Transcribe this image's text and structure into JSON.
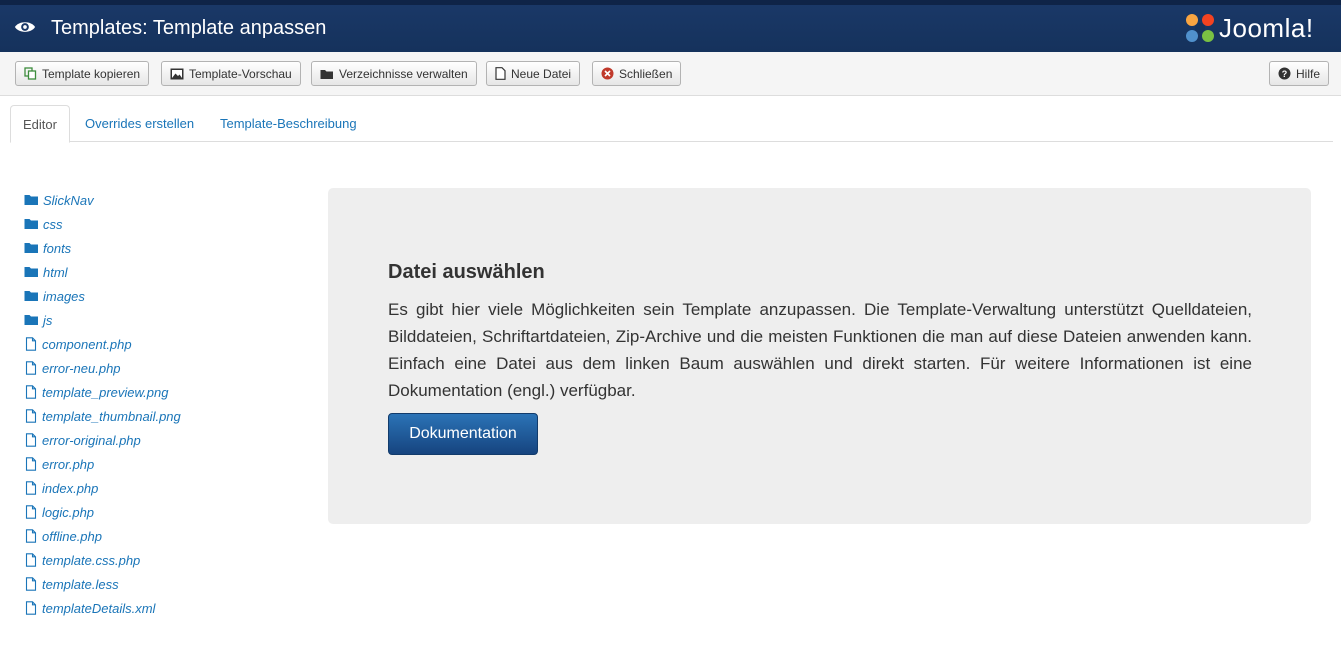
{
  "header": {
    "title": "Templates: Template anpassen",
    "logo_text": "Joomla!"
  },
  "toolbar": {
    "buttons": [
      {
        "label": "Template kopieren",
        "icon": "copy-icon"
      },
      {
        "label": "Template-Vorschau",
        "icon": "picture-icon"
      },
      {
        "label": "Verzeichnisse verwalten",
        "icon": "folder-icon"
      },
      {
        "label": "Neue Datei",
        "icon": "file-icon"
      },
      {
        "label": "Schließen",
        "icon": "close-circle-icon"
      }
    ],
    "help": {
      "label": "Hilfe",
      "icon": "question-circle-icon"
    }
  },
  "tabs": [
    {
      "label": "Editor",
      "active": true
    },
    {
      "label": "Overrides erstellen",
      "active": false
    },
    {
      "label": "Template-Beschreibung",
      "active": false
    }
  ],
  "tree": {
    "folders": [
      "SlickNav",
      "css",
      "fonts",
      "html",
      "images",
      "js"
    ],
    "files": [
      "component.php",
      "error-neu.php",
      "template_preview.png",
      "template_thumbnail.png",
      "error-original.php",
      "error.php",
      "index.php",
      "logic.php",
      "offline.php",
      "template.css.php",
      "template.less",
      "templateDetails.xml"
    ]
  },
  "panel": {
    "title": "Datei auswählen",
    "text": "Es gibt hier viele Möglichkeiten sein Template anzupassen. Die Template-Verwaltung unterstützt Quelldateien, Bilddateien, Schriftartdateien, Zip-Archive und die meisten Funktionen die man auf diese Dateien anwenden kann. Einfach eine Datei aus dem linken Baum auswählen und direkt starten. Für weitere Informationen ist eine Dokumentation (engl.) verfügbar.",
    "button_label": "Dokumentation"
  },
  "colors": {
    "header_bg": "#1a3867",
    "link": "#1a75b8",
    "panel_bg": "#eeeeee",
    "primary_button": "#1f5b9c"
  }
}
